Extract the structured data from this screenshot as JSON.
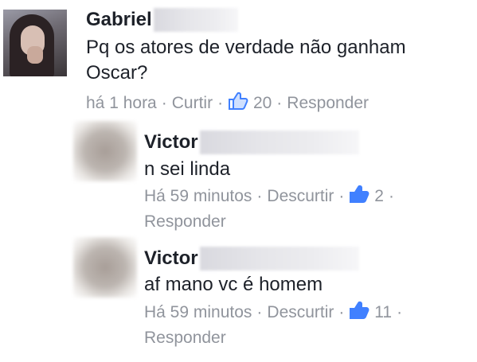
{
  "comments": [
    {
      "name": "Gabriel",
      "text_lines": [
        "Pq os atores de verdade não ganham",
        "Oscar?"
      ],
      "time": "há 1 hora",
      "like_action": "Curtir",
      "like_count": "20",
      "reply_action": "Responder"
    },
    {
      "name": "Victor",
      "text_lines": [
        "n sei linda"
      ],
      "time": "Há 59 minutos",
      "like_action": "Descurtir",
      "like_count": "2",
      "reply_action": "Responder"
    },
    {
      "name": "Victor",
      "text_lines": [
        "af mano vc é homem"
      ],
      "time": "Há 59 minutos",
      "like_action": "Descurtir",
      "like_count": "11",
      "reply_action": "Responder"
    }
  ],
  "separator": "·",
  "colors": {
    "meta": "#90949c",
    "like_icon": "#4080ff",
    "text": "#1d2129"
  },
  "icons": {
    "like": "thumbs-up-icon"
  }
}
